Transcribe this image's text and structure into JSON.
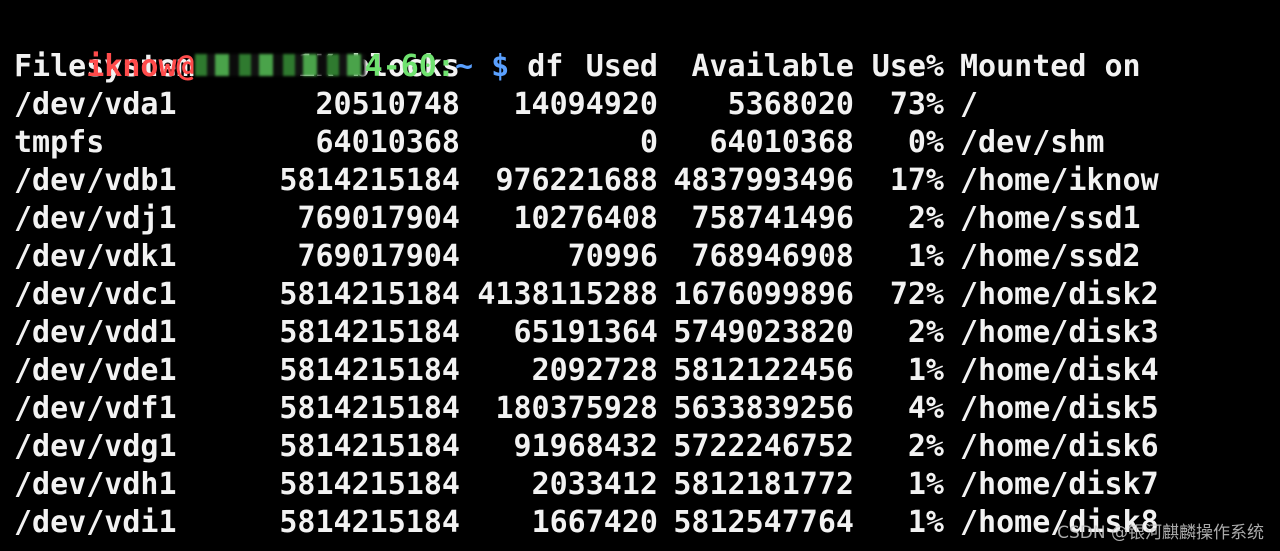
{
  "prompt": {
    "user": "iknow@",
    "host_suffix": "4-60:",
    "path": "~",
    "symbol": "$",
    "command": "df"
  },
  "df": {
    "headers": [
      "Filesystem",
      "1K-blocks",
      "Used",
      "Available",
      "Use%",
      "Mounted on"
    ],
    "rows": [
      [
        "/dev/vda1",
        "20510748",
        "14094920",
        "5368020",
        "73%",
        "/"
      ],
      [
        "tmpfs",
        "64010368",
        "0",
        "64010368",
        "0%",
        "/dev/shm"
      ],
      [
        "/dev/vdb1",
        "5814215184",
        "976221688",
        "4837993496",
        "17%",
        "/home/iknow"
      ],
      [
        "/dev/vdj1",
        "769017904",
        "10276408",
        "758741496",
        "2%",
        "/home/ssd1"
      ],
      [
        "/dev/vdk1",
        "769017904",
        "70996",
        "768946908",
        "1%",
        "/home/ssd2"
      ],
      [
        "/dev/vdc1",
        "5814215184",
        "4138115288",
        "1676099896",
        "72%",
        "/home/disk2"
      ],
      [
        "/dev/vdd1",
        "5814215184",
        "65191364",
        "5749023820",
        "2%",
        "/home/disk3"
      ],
      [
        "/dev/vde1",
        "5814215184",
        "2092728",
        "5812122456",
        "1%",
        "/home/disk4"
      ],
      [
        "/dev/vdf1",
        "5814215184",
        "180375928",
        "5633839256",
        "4%",
        "/home/disk5"
      ],
      [
        "/dev/vdg1",
        "5814215184",
        "91968432",
        "5722246752",
        "2%",
        "/home/disk6"
      ],
      [
        "/dev/vdh1",
        "5814215184",
        "2033412",
        "5812181772",
        "1%",
        "/home/disk7"
      ],
      [
        "/dev/vdi1",
        "5814215184",
        "1667420",
        "5812547764",
        "1%",
        "/home/disk8"
      ]
    ]
  },
  "watermark": "CSDN @银河麒麟操作系统",
  "colors": {
    "background": "#000000",
    "text": "#f2f2f2",
    "user": "#ff4b4b",
    "host": "#6fe26f",
    "prompt_symbol": "#5aa0ff"
  }
}
